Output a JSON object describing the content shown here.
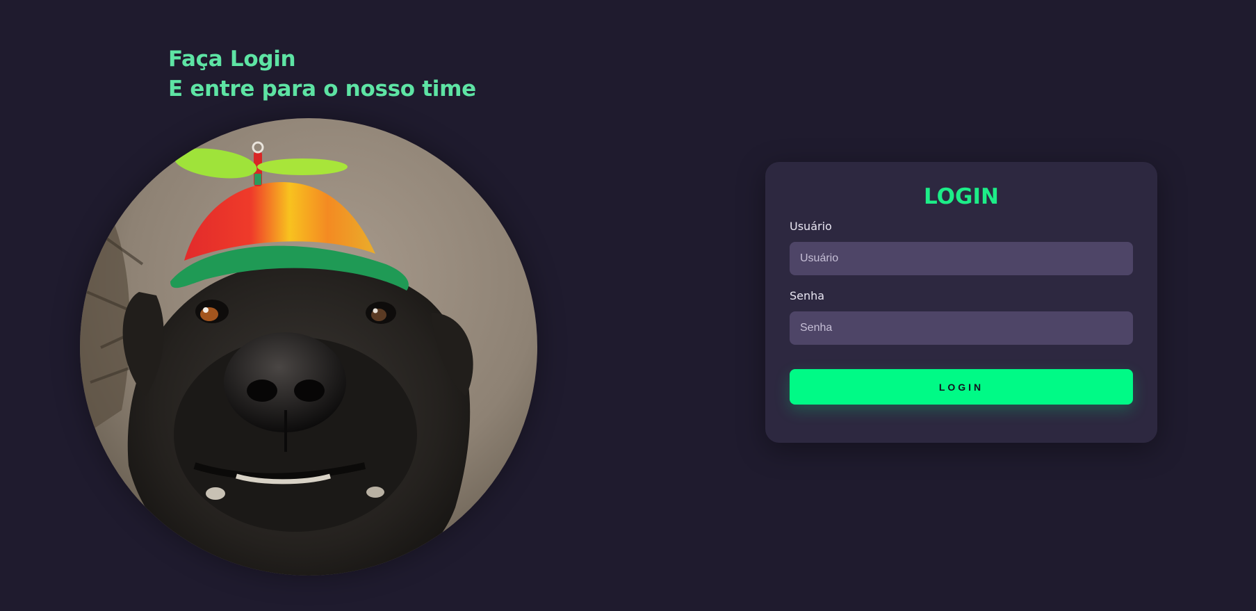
{
  "hero": {
    "line1": "Faça Login",
    "line2": "E entre para o nosso time",
    "image": "dog-with-propeller-hat"
  },
  "login_card": {
    "title": "LOGIN",
    "username": {
      "label": "Usuário",
      "placeholder": "Usuário",
      "value": ""
    },
    "password": {
      "label": "Senha",
      "placeholder": "Senha",
      "value": ""
    },
    "submit_label": "LOGIN"
  },
  "colors": {
    "background": "#1f1b2e",
    "card": "#2d2840",
    "input": "#4e4567",
    "accent": "#00fa86",
    "heading": "#5ee4a4"
  }
}
